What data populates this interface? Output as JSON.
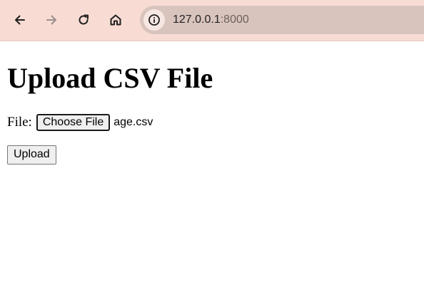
{
  "browser": {
    "url_host": "127.0.0.1",
    "url_port": ":8000",
    "icons": {
      "back": "back-arrow-icon",
      "forward": "forward-arrow-icon",
      "reload": "reload-icon",
      "home": "home-icon",
      "site_info": "info-icon"
    },
    "colors": {
      "toolbar": "#f8dcd4",
      "omnibox": "#d9c4bd"
    }
  },
  "page": {
    "title": "Upload CSV File",
    "file_label": "File:",
    "choose_file_label": "Choose File",
    "selected_file": "age.csv",
    "upload_label": "Upload"
  }
}
